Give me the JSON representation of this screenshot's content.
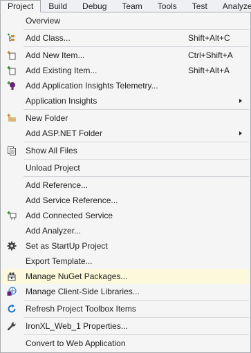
{
  "menubar": {
    "items": [
      {
        "label": "Project"
      },
      {
        "label": "Build"
      },
      {
        "label": "Debug"
      },
      {
        "label": "Team"
      },
      {
        "label": "Tools"
      },
      {
        "label": "Test"
      },
      {
        "label": "Analyze"
      }
    ]
  },
  "menu": {
    "overview": {
      "label": "Overview"
    },
    "add_class": {
      "label": "Add Class...",
      "shortcut": "Shift+Alt+C",
      "icon": "add-class-icon"
    },
    "add_new_item": {
      "label": "Add New Item...",
      "shortcut": "Ctrl+Shift+A",
      "icon": "add-new-item-icon"
    },
    "add_existing_item": {
      "label": "Add Existing Item...",
      "shortcut": "Shift+Alt+A",
      "icon": "add-existing-item-icon"
    },
    "add_app_insights_telemetry": {
      "label": "Add Application Insights Telemetry...",
      "icon": "app-insights-icon"
    },
    "application_insights": {
      "label": "Application Insights"
    },
    "new_folder": {
      "label": "New Folder",
      "icon": "new-folder-icon"
    },
    "add_aspnet_folder": {
      "label": "Add ASP.NET Folder"
    },
    "show_all_files": {
      "label": "Show All Files",
      "icon": "show-all-files-icon"
    },
    "unload_project": {
      "label": "Unload Project"
    },
    "add_reference": {
      "label": "Add Reference..."
    },
    "add_service_reference": {
      "label": "Add Service Reference..."
    },
    "add_connected_service": {
      "label": "Add Connected Service",
      "icon": "connected-service-icon"
    },
    "add_analyzer": {
      "label": "Add Analyzer..."
    },
    "set_startup_project": {
      "label": "Set as StartUp Project",
      "icon": "gear-icon"
    },
    "export_template": {
      "label": "Export Template..."
    },
    "manage_nuget": {
      "label": "Manage NuGet Packages...",
      "icon": "nuget-icon"
    },
    "manage_client_libraries": {
      "label": "Manage Client-Side Libraries...",
      "icon": "client-libraries-icon"
    },
    "refresh_toolbox": {
      "label": "Refresh Project Toolbox Items",
      "icon": "refresh-icon"
    },
    "properties": {
      "label": "IronXL_Web_1 Properties...",
      "icon": "wrench-icon"
    },
    "convert_web_app": {
      "label": "Convert to Web Application"
    }
  },
  "colors": {
    "highlight": "#fcf8db",
    "menu_background": "#f5f5f5",
    "border": "#a7abb0",
    "refresh_blue": "#1e73be",
    "insights_purple": "#68217a"
  }
}
